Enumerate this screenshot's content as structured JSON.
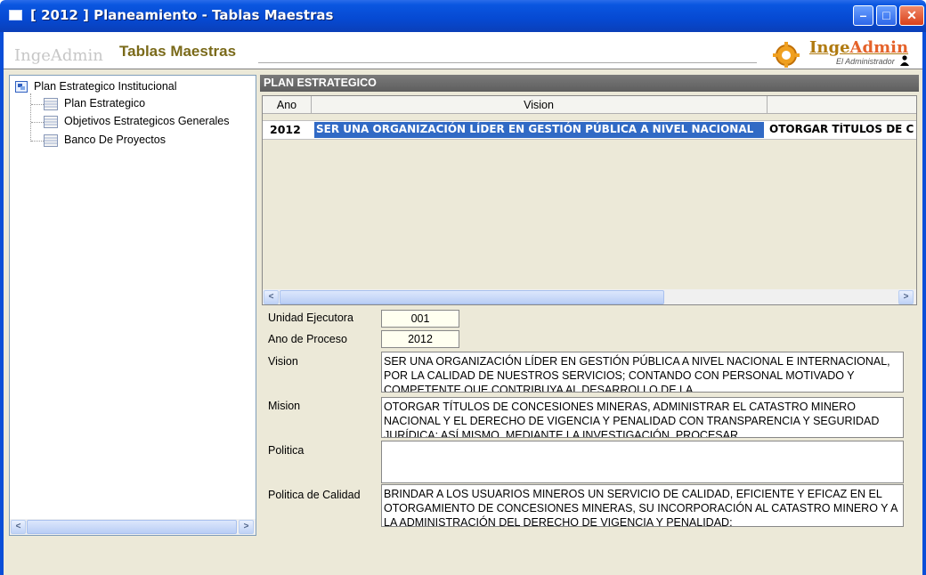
{
  "window": {
    "title": "[ 2012 ] Planeamiento - Tablas Maestras"
  },
  "header": {
    "brand_text": "IngeAdmin",
    "title": "Tablas Maestras",
    "logo_inge": "Inge",
    "logo_admin": "Admin",
    "logo_subtitle": "El Administrador"
  },
  "tree": {
    "root": "Plan Estrategico Institucional",
    "items": [
      {
        "label": "Plan Estrategico"
      },
      {
        "label": "Objetivos Estrategicos Generales"
      },
      {
        "label": "Banco De Proyectos"
      }
    ]
  },
  "section": {
    "title": "PLAN ESTRATEGICO"
  },
  "grid": {
    "columns": [
      "Ano",
      "Vision"
    ],
    "rows": [
      {
        "ano": "2012",
        "vision": "SER UNA ORGANIZACIÓN LÍDER EN GESTIÓN PÚBLICA A NIVEL NACIONAL",
        "mision": "OTORGAR TÍTULOS DE C"
      }
    ]
  },
  "form": {
    "unidad_label": "Unidad Ejecutora",
    "unidad_value": "001",
    "ano_label": "Ano de Proceso",
    "ano_value": "2012",
    "vision_label": "Vision",
    "vision_value": "SER UNA ORGANIZACIÓN LÍDER EN GESTIÓN PÚBLICA A NIVEL NACIONAL E INTERNACIONAL, POR LA CALIDAD DE NUESTROS SERVICIOS; CONTANDO CON PERSONAL MOTIVADO Y COMPETENTE QUE CONTRIBUYA AL DESARROLLO DE LA",
    "mision_label": "Mision",
    "mision_value": "OTORGAR TÍTULOS DE CONCESIONES MINERAS, ADMINISTRAR EL  CATASTRO MINERO NACIONAL Y EL DERECHO DE VIGENCIA Y PENALIDAD CON TRANSPARENCIA Y SEGURIDAD JURÍDICA; ASÍ MISMO, MEDIANTE LA INVESTIGACIÓN, PROCESAR",
    "politica_label": "Politica",
    "politica_value": "",
    "calidad_label": "Politica de Calidad",
    "calidad_value": "BRINDAR A LOS USUARIOS MINEROS UN SERVICIO DE CALIDAD, EFICIENTE Y EFICAZ EN EL OTORGAMIENTO DE CONCESIONES MINERAS, SU INCORPORACIÓN AL CATASTRO MINERO Y A LA ADMINISTRACIÓN DEL DERECHO DE VIGENCIA Y PENALIDAD;"
  },
  "colors": {
    "titlebar": "#0649d2",
    "selection": "#316ac5",
    "section_bar": "#6b6b6b",
    "header_title": "#7a6a1a"
  }
}
